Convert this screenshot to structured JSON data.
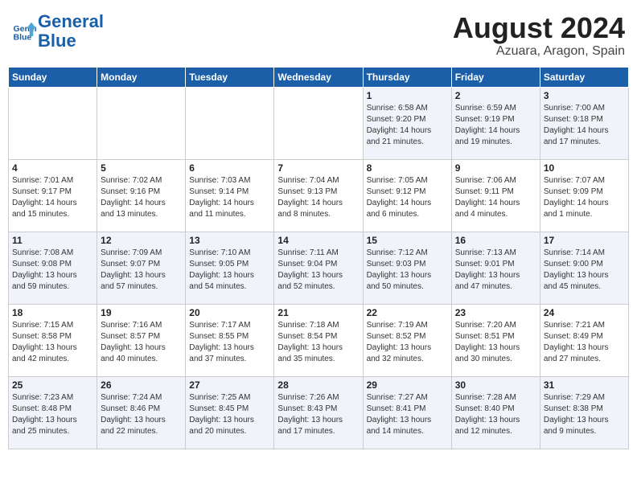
{
  "header": {
    "logo_line1": "General",
    "logo_line2": "Blue",
    "month_title": "August 2024",
    "location": "Azuara, Aragon, Spain"
  },
  "weekdays": [
    "Sunday",
    "Monday",
    "Tuesday",
    "Wednesday",
    "Thursday",
    "Friday",
    "Saturday"
  ],
  "weeks": [
    [
      {
        "day": "",
        "info": ""
      },
      {
        "day": "",
        "info": ""
      },
      {
        "day": "",
        "info": ""
      },
      {
        "day": "",
        "info": ""
      },
      {
        "day": "1",
        "info": "Sunrise: 6:58 AM\nSunset: 9:20 PM\nDaylight: 14 hours\nand 21 minutes."
      },
      {
        "day": "2",
        "info": "Sunrise: 6:59 AM\nSunset: 9:19 PM\nDaylight: 14 hours\nand 19 minutes."
      },
      {
        "day": "3",
        "info": "Sunrise: 7:00 AM\nSunset: 9:18 PM\nDaylight: 14 hours\nand 17 minutes."
      }
    ],
    [
      {
        "day": "4",
        "info": "Sunrise: 7:01 AM\nSunset: 9:17 PM\nDaylight: 14 hours\nand 15 minutes."
      },
      {
        "day": "5",
        "info": "Sunrise: 7:02 AM\nSunset: 9:16 PM\nDaylight: 14 hours\nand 13 minutes."
      },
      {
        "day": "6",
        "info": "Sunrise: 7:03 AM\nSunset: 9:14 PM\nDaylight: 14 hours\nand 11 minutes."
      },
      {
        "day": "7",
        "info": "Sunrise: 7:04 AM\nSunset: 9:13 PM\nDaylight: 14 hours\nand 8 minutes."
      },
      {
        "day": "8",
        "info": "Sunrise: 7:05 AM\nSunset: 9:12 PM\nDaylight: 14 hours\nand 6 minutes."
      },
      {
        "day": "9",
        "info": "Sunrise: 7:06 AM\nSunset: 9:11 PM\nDaylight: 14 hours\nand 4 minutes."
      },
      {
        "day": "10",
        "info": "Sunrise: 7:07 AM\nSunset: 9:09 PM\nDaylight: 14 hours\nand 1 minute."
      }
    ],
    [
      {
        "day": "11",
        "info": "Sunrise: 7:08 AM\nSunset: 9:08 PM\nDaylight: 13 hours\nand 59 minutes."
      },
      {
        "day": "12",
        "info": "Sunrise: 7:09 AM\nSunset: 9:07 PM\nDaylight: 13 hours\nand 57 minutes."
      },
      {
        "day": "13",
        "info": "Sunrise: 7:10 AM\nSunset: 9:05 PM\nDaylight: 13 hours\nand 54 minutes."
      },
      {
        "day": "14",
        "info": "Sunrise: 7:11 AM\nSunset: 9:04 PM\nDaylight: 13 hours\nand 52 minutes."
      },
      {
        "day": "15",
        "info": "Sunrise: 7:12 AM\nSunset: 9:03 PM\nDaylight: 13 hours\nand 50 minutes."
      },
      {
        "day": "16",
        "info": "Sunrise: 7:13 AM\nSunset: 9:01 PM\nDaylight: 13 hours\nand 47 minutes."
      },
      {
        "day": "17",
        "info": "Sunrise: 7:14 AM\nSunset: 9:00 PM\nDaylight: 13 hours\nand 45 minutes."
      }
    ],
    [
      {
        "day": "18",
        "info": "Sunrise: 7:15 AM\nSunset: 8:58 PM\nDaylight: 13 hours\nand 42 minutes."
      },
      {
        "day": "19",
        "info": "Sunrise: 7:16 AM\nSunset: 8:57 PM\nDaylight: 13 hours\nand 40 minutes."
      },
      {
        "day": "20",
        "info": "Sunrise: 7:17 AM\nSunset: 8:55 PM\nDaylight: 13 hours\nand 37 minutes."
      },
      {
        "day": "21",
        "info": "Sunrise: 7:18 AM\nSunset: 8:54 PM\nDaylight: 13 hours\nand 35 minutes."
      },
      {
        "day": "22",
        "info": "Sunrise: 7:19 AM\nSunset: 8:52 PM\nDaylight: 13 hours\nand 32 minutes."
      },
      {
        "day": "23",
        "info": "Sunrise: 7:20 AM\nSunset: 8:51 PM\nDaylight: 13 hours\nand 30 minutes."
      },
      {
        "day": "24",
        "info": "Sunrise: 7:21 AM\nSunset: 8:49 PM\nDaylight: 13 hours\nand 27 minutes."
      }
    ],
    [
      {
        "day": "25",
        "info": "Sunrise: 7:23 AM\nSunset: 8:48 PM\nDaylight: 13 hours\nand 25 minutes."
      },
      {
        "day": "26",
        "info": "Sunrise: 7:24 AM\nSunset: 8:46 PM\nDaylight: 13 hours\nand 22 minutes."
      },
      {
        "day": "27",
        "info": "Sunrise: 7:25 AM\nSunset: 8:45 PM\nDaylight: 13 hours\nand 20 minutes."
      },
      {
        "day": "28",
        "info": "Sunrise: 7:26 AM\nSunset: 8:43 PM\nDaylight: 13 hours\nand 17 minutes."
      },
      {
        "day": "29",
        "info": "Sunrise: 7:27 AM\nSunset: 8:41 PM\nDaylight: 13 hours\nand 14 minutes."
      },
      {
        "day": "30",
        "info": "Sunrise: 7:28 AM\nSunset: 8:40 PM\nDaylight: 13 hours\nand 12 minutes."
      },
      {
        "day": "31",
        "info": "Sunrise: 7:29 AM\nSunset: 8:38 PM\nDaylight: 13 hours\nand 9 minutes."
      }
    ]
  ]
}
